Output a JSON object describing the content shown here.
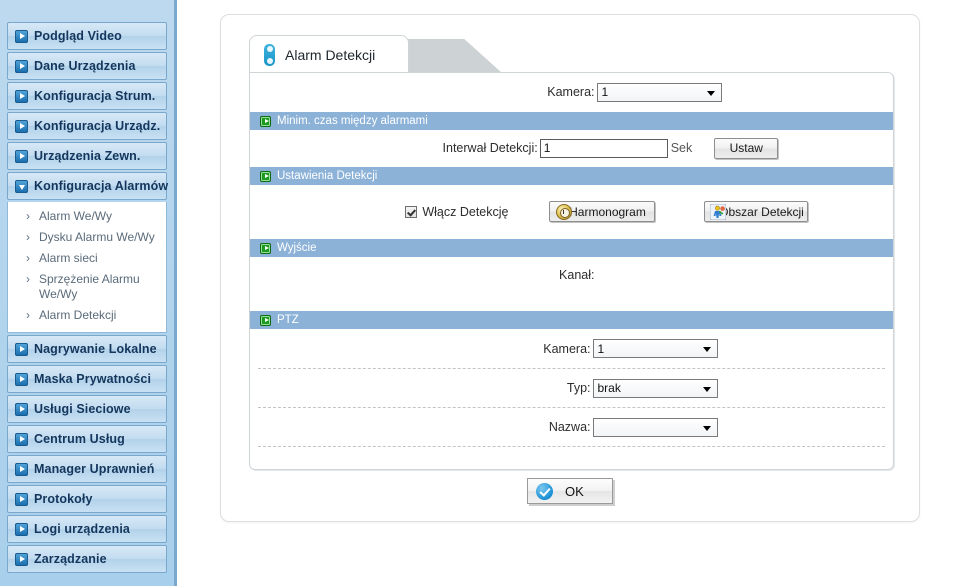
{
  "sidebar": {
    "items": [
      {
        "label": "Podgląd Video",
        "icon": "play-right-icon",
        "active": false
      },
      {
        "label": "Dane Urządzenia",
        "icon": "play-right-icon",
        "active": false
      },
      {
        "label": "Konfiguracja Strum.",
        "icon": "play-right-icon",
        "active": false
      },
      {
        "label": "Konfiguracja Urządz.",
        "icon": "play-right-icon",
        "active": false
      },
      {
        "label": "Urządzenia Zewn.",
        "icon": "play-right-icon",
        "active": false
      },
      {
        "label": "Konfiguracja Alarmów",
        "icon": "play-down-icon",
        "active": true
      }
    ],
    "submenu": [
      {
        "label": "Alarm We/Wy"
      },
      {
        "label": "Dysku Alarmu We/Wy"
      },
      {
        "label": "Alarm sieci"
      },
      {
        "label": "Sprzężenie Alarmu We/Wy"
      },
      {
        "label": "Alarm Detekcji"
      }
    ],
    "items_after": [
      {
        "label": "Nagrywanie Lokalne",
        "icon": "play-right-icon"
      },
      {
        "label": "Maska Prywatności",
        "icon": "play-right-icon"
      },
      {
        "label": "Usługi Sieciowe",
        "icon": "play-right-icon"
      },
      {
        "label": "Centrum Usług",
        "icon": "play-right-icon"
      },
      {
        "label": "Manager Uprawnień",
        "icon": "play-right-icon"
      },
      {
        "label": "Protokoły",
        "icon": "play-right-icon"
      },
      {
        "label": "Logi urządzenia",
        "icon": "play-right-icon"
      },
      {
        "label": "Zarządzanie",
        "icon": "play-right-icon"
      }
    ],
    "arrow_glyph": "›",
    "colors": {
      "bg": "#b5d5ed",
      "item_border": "#7aa8cc",
      "label": "#14365c"
    }
  },
  "tab": {
    "label": "Alarm Detekcji",
    "icon": "camera-module-icon"
  },
  "form": {
    "camera_top": {
      "label": "Kamera:",
      "value": "1",
      "options": [
        "1"
      ]
    },
    "section_interval": {
      "title": "Minim. czas między alarmami",
      "icon": "green-arrow-icon",
      "field_label": "Interwał Detekcji:",
      "field_value": "1",
      "unit": "Sek",
      "button": "Ustaw"
    },
    "section_detection": {
      "title": "Ustawienia Detekcji",
      "icon": "green-arrow-icon",
      "checkbox_label": "Włącz Detekcję",
      "checkbox_checked": true,
      "button_schedule": "Harmonogram",
      "button_schedule_icon": "clock-icon",
      "button_area": "Obszar Detekcji",
      "button_area_icon": "detection-area-icon"
    },
    "section_output": {
      "title": "Wyjście",
      "icon": "green-arrow-icon",
      "channel_label": "Kanał:"
    },
    "section_ptz": {
      "title": "PTZ",
      "icon": "green-arrow-icon",
      "rows": [
        {
          "label": "Kamera:",
          "value": "1",
          "options": [
            "1"
          ]
        },
        {
          "label": "Typ:",
          "value": "brak",
          "options": [
            "brak"
          ]
        },
        {
          "label": "Nazwa:",
          "value": "",
          "options": [
            ""
          ]
        }
      ]
    }
  },
  "footer": {
    "ok_label": "OK",
    "ok_icon": "check-circle-icon"
  },
  "colors": {
    "section_header_bg": "#8cb2d8",
    "section_icon_green": "#1d9b20",
    "accent_blue": "#1a8fd6",
    "sidebar_gradient_top": "#d7e9f7"
  }
}
